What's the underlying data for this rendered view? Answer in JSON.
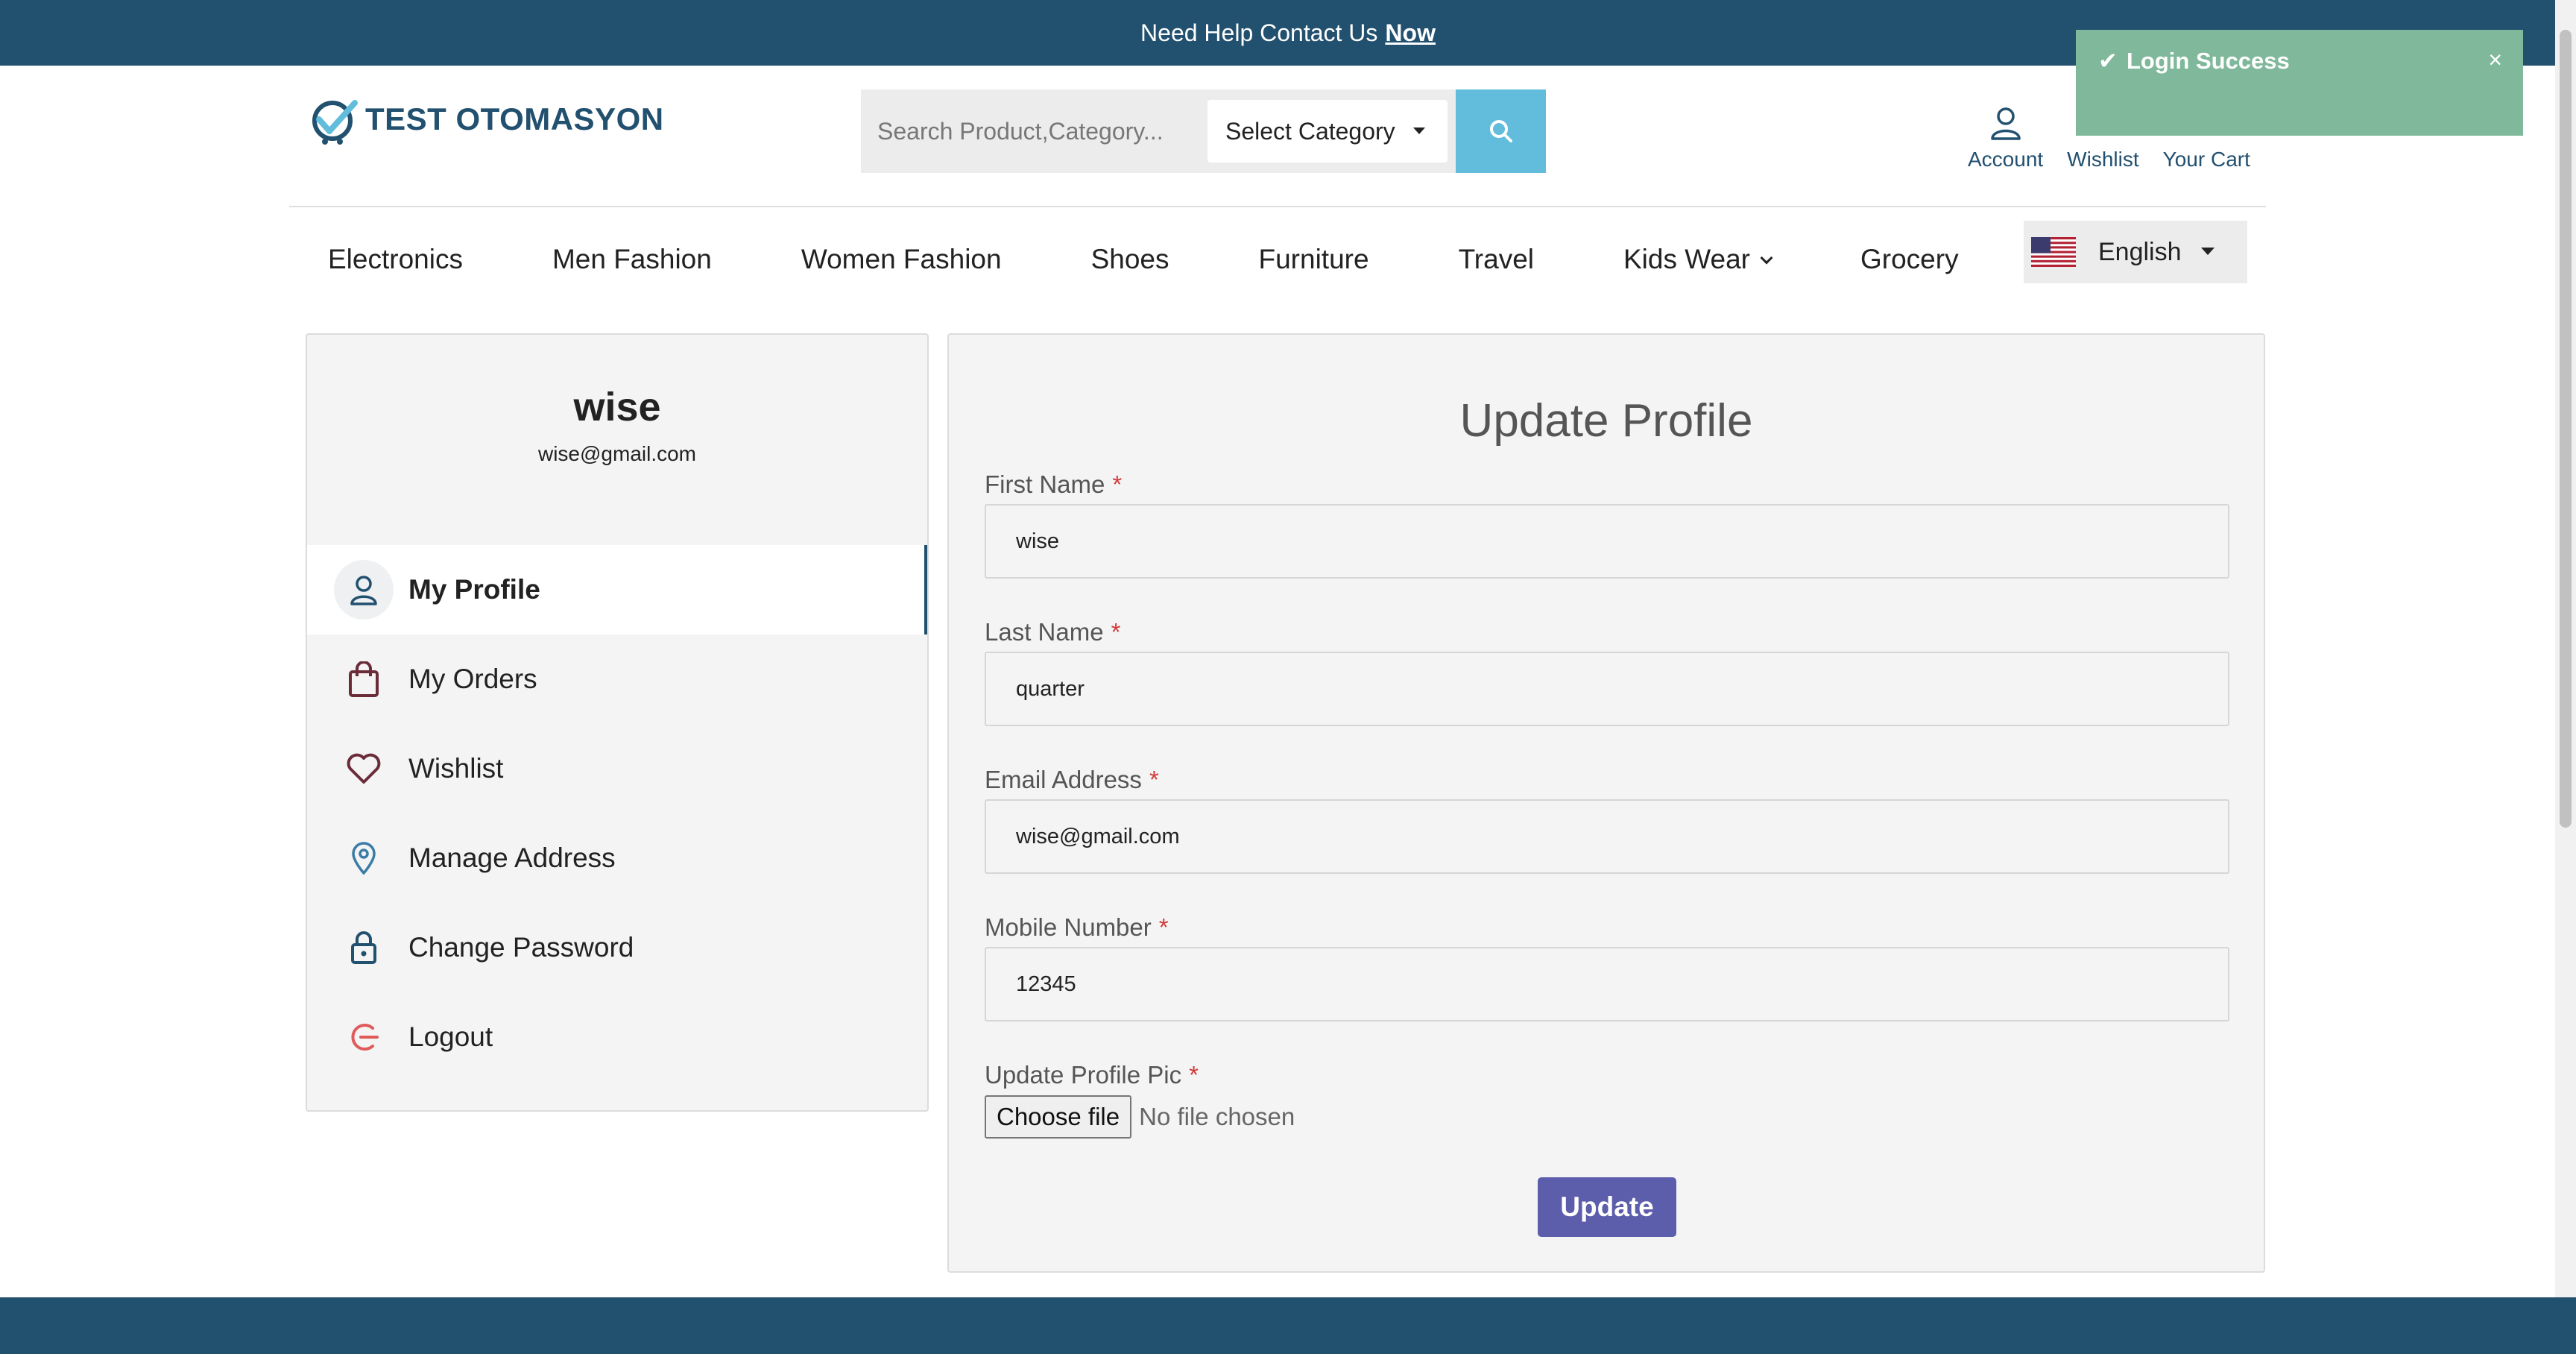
{
  "topbar": {
    "text": "Need Help Contact Us",
    "link": "Now"
  },
  "toast": {
    "message": "Login Success",
    "close": "×"
  },
  "logo": {
    "text": "TEST OTOMASYON"
  },
  "search": {
    "placeholder": "Search Product,Category...",
    "category": "Select Category"
  },
  "header_links": {
    "account": "Account",
    "wishlist": "Wishlist",
    "cart": "Your Cart"
  },
  "nav": {
    "items": [
      "Electronics",
      "Men Fashion",
      "Women Fashion",
      "Shoes",
      "Furniture",
      "Travel",
      "Kids Wear",
      "Grocery"
    ]
  },
  "language": {
    "selected": "English"
  },
  "profile": {
    "name": "wise",
    "email": "wise@gmail.com"
  },
  "menu": {
    "items": [
      {
        "label": "My Profile",
        "icon": "user-icon"
      },
      {
        "label": "My Orders",
        "icon": "shopping-bag-icon"
      },
      {
        "label": "Wishlist",
        "icon": "heart-icon"
      },
      {
        "label": "Manage Address",
        "icon": "location-pin-icon"
      },
      {
        "label": "Change Password",
        "icon": "lock-icon"
      },
      {
        "label": "Logout",
        "icon": "logout-icon"
      }
    ]
  },
  "form": {
    "title": "Update Profile",
    "first_name_label": "First Name",
    "first_name_value": "wise",
    "last_name_label": "Last Name",
    "last_name_value": "quarter",
    "email_label": "Email Address",
    "email_value": "wise@gmail.com",
    "mobile_label": "Mobile Number",
    "mobile_value": "12345",
    "pic_label": "Update Profile Pic",
    "choose_file": "Choose file",
    "no_file": "No file chosen",
    "required_mark": "*",
    "submit": "Update"
  },
  "colors": {
    "brand": "#22506f",
    "search_button": "#62bcdc",
    "toast": "#7fb89a",
    "submit": "#5d5eab",
    "required": "#d23b3b"
  }
}
